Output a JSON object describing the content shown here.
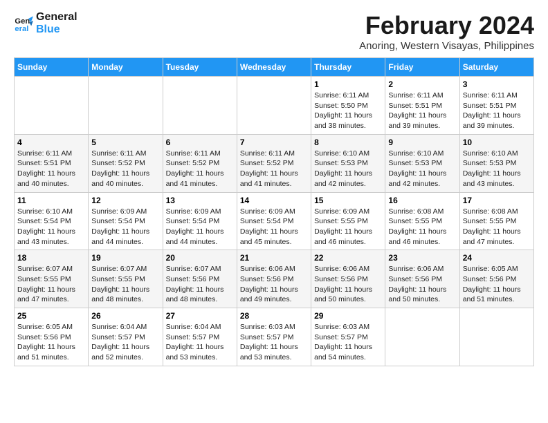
{
  "logo": {
    "line1": "General",
    "line2": "Blue"
  },
  "title": "February 2024",
  "subtitle": "Anoring, Western Visayas, Philippines",
  "headers": [
    "Sunday",
    "Monday",
    "Tuesday",
    "Wednesday",
    "Thursday",
    "Friday",
    "Saturday"
  ],
  "weeks": [
    [
      {
        "day": "",
        "info": ""
      },
      {
        "day": "",
        "info": ""
      },
      {
        "day": "",
        "info": ""
      },
      {
        "day": "",
        "info": ""
      },
      {
        "day": "1",
        "info": "Sunrise: 6:11 AM\nSunset: 5:50 PM\nDaylight: 11 hours\nand 38 minutes."
      },
      {
        "day": "2",
        "info": "Sunrise: 6:11 AM\nSunset: 5:51 PM\nDaylight: 11 hours\nand 39 minutes."
      },
      {
        "day": "3",
        "info": "Sunrise: 6:11 AM\nSunset: 5:51 PM\nDaylight: 11 hours\nand 39 minutes."
      }
    ],
    [
      {
        "day": "4",
        "info": "Sunrise: 6:11 AM\nSunset: 5:51 PM\nDaylight: 11 hours\nand 40 minutes."
      },
      {
        "day": "5",
        "info": "Sunrise: 6:11 AM\nSunset: 5:52 PM\nDaylight: 11 hours\nand 40 minutes."
      },
      {
        "day": "6",
        "info": "Sunrise: 6:11 AM\nSunset: 5:52 PM\nDaylight: 11 hours\nand 41 minutes."
      },
      {
        "day": "7",
        "info": "Sunrise: 6:11 AM\nSunset: 5:52 PM\nDaylight: 11 hours\nand 41 minutes."
      },
      {
        "day": "8",
        "info": "Sunrise: 6:10 AM\nSunset: 5:53 PM\nDaylight: 11 hours\nand 42 minutes."
      },
      {
        "day": "9",
        "info": "Sunrise: 6:10 AM\nSunset: 5:53 PM\nDaylight: 11 hours\nand 42 minutes."
      },
      {
        "day": "10",
        "info": "Sunrise: 6:10 AM\nSunset: 5:53 PM\nDaylight: 11 hours\nand 43 minutes."
      }
    ],
    [
      {
        "day": "11",
        "info": "Sunrise: 6:10 AM\nSunset: 5:54 PM\nDaylight: 11 hours\nand 43 minutes."
      },
      {
        "day": "12",
        "info": "Sunrise: 6:09 AM\nSunset: 5:54 PM\nDaylight: 11 hours\nand 44 minutes."
      },
      {
        "day": "13",
        "info": "Sunrise: 6:09 AM\nSunset: 5:54 PM\nDaylight: 11 hours\nand 44 minutes."
      },
      {
        "day": "14",
        "info": "Sunrise: 6:09 AM\nSunset: 5:54 PM\nDaylight: 11 hours\nand 45 minutes."
      },
      {
        "day": "15",
        "info": "Sunrise: 6:09 AM\nSunset: 5:55 PM\nDaylight: 11 hours\nand 46 minutes."
      },
      {
        "day": "16",
        "info": "Sunrise: 6:08 AM\nSunset: 5:55 PM\nDaylight: 11 hours\nand 46 minutes."
      },
      {
        "day": "17",
        "info": "Sunrise: 6:08 AM\nSunset: 5:55 PM\nDaylight: 11 hours\nand 47 minutes."
      }
    ],
    [
      {
        "day": "18",
        "info": "Sunrise: 6:07 AM\nSunset: 5:55 PM\nDaylight: 11 hours\nand 47 minutes."
      },
      {
        "day": "19",
        "info": "Sunrise: 6:07 AM\nSunset: 5:55 PM\nDaylight: 11 hours\nand 48 minutes."
      },
      {
        "day": "20",
        "info": "Sunrise: 6:07 AM\nSunset: 5:56 PM\nDaylight: 11 hours\nand 48 minutes."
      },
      {
        "day": "21",
        "info": "Sunrise: 6:06 AM\nSunset: 5:56 PM\nDaylight: 11 hours\nand 49 minutes."
      },
      {
        "day": "22",
        "info": "Sunrise: 6:06 AM\nSunset: 5:56 PM\nDaylight: 11 hours\nand 50 minutes."
      },
      {
        "day": "23",
        "info": "Sunrise: 6:06 AM\nSunset: 5:56 PM\nDaylight: 11 hours\nand 50 minutes."
      },
      {
        "day": "24",
        "info": "Sunrise: 6:05 AM\nSunset: 5:56 PM\nDaylight: 11 hours\nand 51 minutes."
      }
    ],
    [
      {
        "day": "25",
        "info": "Sunrise: 6:05 AM\nSunset: 5:56 PM\nDaylight: 11 hours\nand 51 minutes."
      },
      {
        "day": "26",
        "info": "Sunrise: 6:04 AM\nSunset: 5:57 PM\nDaylight: 11 hours\nand 52 minutes."
      },
      {
        "day": "27",
        "info": "Sunrise: 6:04 AM\nSunset: 5:57 PM\nDaylight: 11 hours\nand 53 minutes."
      },
      {
        "day": "28",
        "info": "Sunrise: 6:03 AM\nSunset: 5:57 PM\nDaylight: 11 hours\nand 53 minutes."
      },
      {
        "day": "29",
        "info": "Sunrise: 6:03 AM\nSunset: 5:57 PM\nDaylight: 11 hours\nand 54 minutes."
      },
      {
        "day": "",
        "info": ""
      },
      {
        "day": "",
        "info": ""
      }
    ]
  ]
}
